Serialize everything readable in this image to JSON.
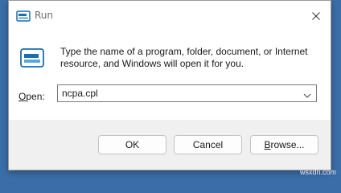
{
  "window": {
    "title": "Run",
    "close_icon": "close-icon",
    "app_icon": "run-icon"
  },
  "content": {
    "description": "Type the name of a program, folder, document, or Internet\nresource, and Windows will open it for you.",
    "open_label_underlined": "O",
    "open_label_rest": "pen:",
    "open_value": "ncpa.cpl"
  },
  "buttons": {
    "ok": "OK",
    "cancel": "Cancel",
    "browse_underlined": "B",
    "browse_rest": "rowse..."
  },
  "watermark": "wsxdn.com",
  "colors": {
    "background": "#3b6ea8",
    "footer": "#f0f0f0",
    "icon_accent": "#1a6fb0"
  }
}
